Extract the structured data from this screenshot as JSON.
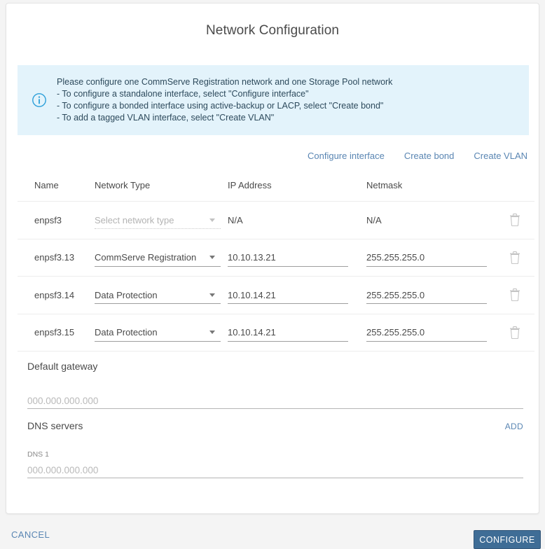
{
  "dialog": {
    "title": "Network Configuration"
  },
  "info_banner": {
    "icon": "info-circle-icon",
    "lines": [
      "Please configure one CommServe Registration network and one Storage Pool network",
      "- To configure a standalone interface, select \"Configure interface\"",
      "- To configure a bonded interface using active-backup or LACP, select \"Create bond\"",
      "- To add a tagged VLAN interface, select \"Create VLAN\""
    ],
    "background": "#e3f3fb",
    "text_color": "#2d4a5c"
  },
  "actions": {
    "configure_interface": "Configure interface",
    "create_bond": "Create bond",
    "create_vlan": "Create VLAN",
    "link_color": "#5a86b3"
  },
  "table": {
    "headers": {
      "name": "Name",
      "network_type": "Network Type",
      "ip_address": "IP Address",
      "netmask": "Netmask"
    },
    "network_type_placeholder": "Select network type",
    "delete_icon": "trash-icon",
    "rows": [
      {
        "name": "enpsf3",
        "network_type": "",
        "network_type_placeholder": "Select network type",
        "network_type_disabled": true,
        "ip_address": "N/A",
        "ip_editable": false,
        "netmask": "N/A",
        "netmask_editable": false
      },
      {
        "name": "enpsf3.13",
        "network_type": "CommServe Registration",
        "network_type_disabled": false,
        "ip_address": "10.10.13.21",
        "ip_editable": true,
        "netmask": "255.255.255.0",
        "netmask_editable": true
      },
      {
        "name": "enpsf3.14",
        "network_type": "Data Protection",
        "network_type_disabled": false,
        "ip_address": "10.10.14.21",
        "ip_editable": true,
        "netmask": "255.255.255.0",
        "netmask_editable": true
      },
      {
        "name": "enpsf3.15",
        "network_type": "Data Protection",
        "network_type_disabled": false,
        "ip_address": "10.10.14.21",
        "ip_editable": true,
        "netmask": "255.255.255.0",
        "netmask_editable": true
      }
    ]
  },
  "gateway": {
    "label": "Default gateway",
    "value": "",
    "placeholder": "000.000.000.000"
  },
  "dns": {
    "label": "DNS servers",
    "add_label": "ADD",
    "entries": [
      {
        "label": "DNS 1",
        "value": "",
        "placeholder": "000.000.000.000"
      }
    ]
  },
  "footer": {
    "cancel_label": "CANCEL",
    "configure_label": "CONFIGURE",
    "configure_bg": "#3f6d96"
  }
}
